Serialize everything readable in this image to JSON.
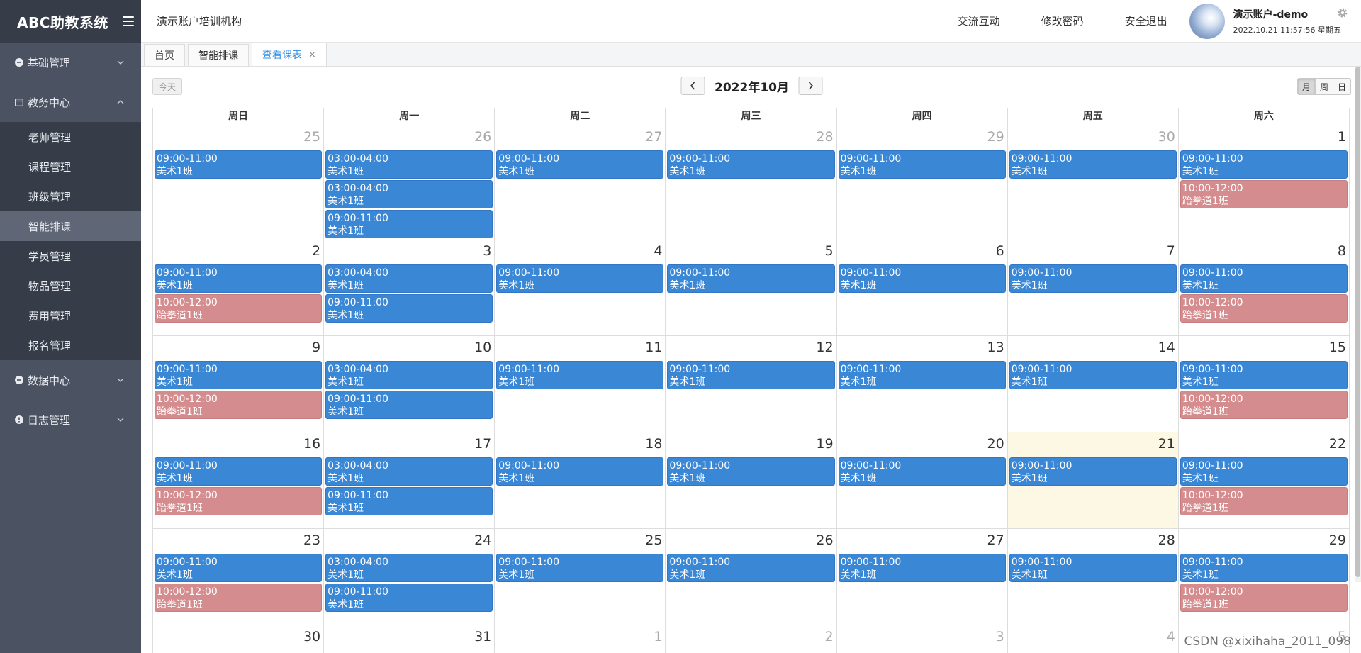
{
  "sidebar": {
    "brand": "ABC助教系统",
    "groups": [
      {
        "label": "基础管理",
        "icon": "circle-minus-icon",
        "expanded": false
      },
      {
        "label": "教务中心",
        "icon": "calendar-icon",
        "expanded": true
      },
      {
        "label": "数据中心",
        "icon": "circle-minus-icon",
        "expanded": false
      },
      {
        "label": "日志管理",
        "icon": "exclamation-icon",
        "expanded": false
      }
    ],
    "sub_items": [
      "老师管理",
      "课程管理",
      "班级管理",
      "智能排课",
      "学员管理",
      "物品管理",
      "费用管理",
      "报名管理"
    ],
    "active_sub": "智能排课"
  },
  "header": {
    "org": "演示账户培训机构",
    "links": [
      "交流互动",
      "修改密码",
      "安全退出"
    ],
    "user_name": "演示账户-demo",
    "datetime": "2022.10.21 11:57:56 星期五"
  },
  "tabs": [
    {
      "label": "首页"
    },
    {
      "label": "智能排课"
    },
    {
      "label": "查看课表",
      "active": true,
      "close": "×"
    }
  ],
  "toolbar": {
    "today": "今天",
    "prev": "‹",
    "next": "›",
    "title": "2022年10月",
    "views": [
      "月",
      "周",
      "日"
    ],
    "active_view": "月"
  },
  "weekdays": [
    "周日",
    "周一",
    "周二",
    "周三",
    "周四",
    "周五",
    "周六"
  ],
  "weeks": [
    [
      {
        "day": "25",
        "other": true,
        "events": [
          {
            "time": "09:00-11:00",
            "title": "美术1班",
            "color": "blue"
          }
        ]
      },
      {
        "day": "26",
        "other": true,
        "events": [
          {
            "time": "03:00-04:00",
            "title": "美术1班",
            "color": "blue"
          },
          {
            "time": "03:00-04:00",
            "title": "美术1班",
            "color": "blue"
          },
          {
            "time": "09:00-11:00",
            "title": "美术1班",
            "color": "blue"
          }
        ]
      },
      {
        "day": "27",
        "other": true,
        "events": [
          {
            "time": "09:00-11:00",
            "title": "美术1班",
            "color": "blue"
          }
        ]
      },
      {
        "day": "28",
        "other": true,
        "events": [
          {
            "time": "09:00-11:00",
            "title": "美术1班",
            "color": "blue"
          }
        ]
      },
      {
        "day": "29",
        "other": true,
        "events": [
          {
            "time": "09:00-11:00",
            "title": "美术1班",
            "color": "blue"
          }
        ]
      },
      {
        "day": "30",
        "other": true,
        "events": [
          {
            "time": "09:00-11:00",
            "title": "美术1班",
            "color": "blue"
          }
        ]
      },
      {
        "day": "1",
        "events": [
          {
            "time": "09:00-11:00",
            "title": "美术1班",
            "color": "blue"
          },
          {
            "time": "10:00-12:00",
            "title": "跆拳道1班",
            "color": "red"
          }
        ]
      }
    ],
    [
      {
        "day": "2",
        "events": [
          {
            "time": "09:00-11:00",
            "title": "美术1班",
            "color": "blue"
          },
          {
            "time": "10:00-12:00",
            "title": "跆拳道1班",
            "color": "red"
          }
        ]
      },
      {
        "day": "3",
        "events": [
          {
            "time": "03:00-04:00",
            "title": "美术1班",
            "color": "blue"
          },
          {
            "time": "09:00-11:00",
            "title": "美术1班",
            "color": "blue"
          }
        ]
      },
      {
        "day": "4",
        "events": [
          {
            "time": "09:00-11:00",
            "title": "美术1班",
            "color": "blue"
          }
        ]
      },
      {
        "day": "5",
        "events": [
          {
            "time": "09:00-11:00",
            "title": "美术1班",
            "color": "blue"
          }
        ]
      },
      {
        "day": "6",
        "events": [
          {
            "time": "09:00-11:00",
            "title": "美术1班",
            "color": "blue"
          }
        ]
      },
      {
        "day": "7",
        "events": [
          {
            "time": "09:00-11:00",
            "title": "美术1班",
            "color": "blue"
          }
        ]
      },
      {
        "day": "8",
        "events": [
          {
            "time": "09:00-11:00",
            "title": "美术1班",
            "color": "blue"
          },
          {
            "time": "10:00-12:00",
            "title": "跆拳道1班",
            "color": "red"
          }
        ]
      }
    ],
    [
      {
        "day": "9",
        "events": [
          {
            "time": "09:00-11:00",
            "title": "美术1班",
            "color": "blue"
          },
          {
            "time": "10:00-12:00",
            "title": "跆拳道1班",
            "color": "red"
          }
        ]
      },
      {
        "day": "10",
        "events": [
          {
            "time": "03:00-04:00",
            "title": "美术1班",
            "color": "blue"
          },
          {
            "time": "09:00-11:00",
            "title": "美术1班",
            "color": "blue"
          }
        ]
      },
      {
        "day": "11",
        "events": [
          {
            "time": "09:00-11:00",
            "title": "美术1班",
            "color": "blue"
          }
        ]
      },
      {
        "day": "12",
        "events": [
          {
            "time": "09:00-11:00",
            "title": "美术1班",
            "color": "blue"
          }
        ]
      },
      {
        "day": "13",
        "events": [
          {
            "time": "09:00-11:00",
            "title": "美术1班",
            "color": "blue"
          }
        ]
      },
      {
        "day": "14",
        "events": [
          {
            "time": "09:00-11:00",
            "title": "美术1班",
            "color": "blue"
          }
        ]
      },
      {
        "day": "15",
        "events": [
          {
            "time": "09:00-11:00",
            "title": "美术1班",
            "color": "blue"
          },
          {
            "time": "10:00-12:00",
            "title": "跆拳道1班",
            "color": "red"
          }
        ]
      }
    ],
    [
      {
        "day": "16",
        "events": [
          {
            "time": "09:00-11:00",
            "title": "美术1班",
            "color": "blue"
          },
          {
            "time": "10:00-12:00",
            "title": "跆拳道1班",
            "color": "red"
          }
        ]
      },
      {
        "day": "17",
        "events": [
          {
            "time": "03:00-04:00",
            "title": "美术1班",
            "color": "blue"
          },
          {
            "time": "09:00-11:00",
            "title": "美术1班",
            "color": "blue"
          }
        ]
      },
      {
        "day": "18",
        "events": [
          {
            "time": "09:00-11:00",
            "title": "美术1班",
            "color": "blue"
          }
        ]
      },
      {
        "day": "19",
        "events": [
          {
            "time": "09:00-11:00",
            "title": "美术1班",
            "color": "blue"
          }
        ]
      },
      {
        "day": "20",
        "events": [
          {
            "time": "09:00-11:00",
            "title": "美术1班",
            "color": "blue"
          }
        ]
      },
      {
        "day": "21",
        "today": true,
        "events": [
          {
            "time": "09:00-11:00",
            "title": "美术1班",
            "color": "blue"
          }
        ]
      },
      {
        "day": "22",
        "events": [
          {
            "time": "09:00-11:00",
            "title": "美术1班",
            "color": "blue"
          },
          {
            "time": "10:00-12:00",
            "title": "跆拳道1班",
            "color": "red"
          }
        ]
      }
    ],
    [
      {
        "day": "23",
        "events": [
          {
            "time": "09:00-11:00",
            "title": "美术1班",
            "color": "blue"
          },
          {
            "time": "10:00-12:00",
            "title": "跆拳道1班",
            "color": "red"
          }
        ]
      },
      {
        "day": "24",
        "events": [
          {
            "time": "03:00-04:00",
            "title": "美术1班",
            "color": "blue"
          },
          {
            "time": "09:00-11:00",
            "title": "美术1班",
            "color": "blue"
          }
        ]
      },
      {
        "day": "25",
        "events": [
          {
            "time": "09:00-11:00",
            "title": "美术1班",
            "color": "blue"
          }
        ]
      },
      {
        "day": "26",
        "events": [
          {
            "time": "09:00-11:00",
            "title": "美术1班",
            "color": "blue"
          }
        ]
      },
      {
        "day": "27",
        "events": [
          {
            "time": "09:00-11:00",
            "title": "美术1班",
            "color": "blue"
          }
        ]
      },
      {
        "day": "28",
        "events": [
          {
            "time": "09:00-11:00",
            "title": "美术1班",
            "color": "blue"
          }
        ]
      },
      {
        "day": "29",
        "events": [
          {
            "time": "09:00-11:00",
            "title": "美术1班",
            "color": "blue"
          },
          {
            "time": "10:00-12:00",
            "title": "跆拳道1班",
            "color": "red"
          }
        ]
      }
    ],
    [
      {
        "day": "30",
        "events": []
      },
      {
        "day": "31",
        "events": []
      },
      {
        "day": "1",
        "other": true,
        "events": []
      },
      {
        "day": "2",
        "other": true,
        "events": []
      },
      {
        "day": "3",
        "other": true,
        "events": []
      },
      {
        "day": "4",
        "other": true,
        "events": []
      },
      {
        "day": "5",
        "other": true,
        "events": []
      }
    ]
  ],
  "watermark": "CSDN @xixihaha_2011_098",
  "colors": {
    "event_blue": "#3a87d6",
    "event_red": "#d48c8e",
    "today_bg": "#fcf8e3",
    "sidebar_bg": "#4b5261"
  }
}
